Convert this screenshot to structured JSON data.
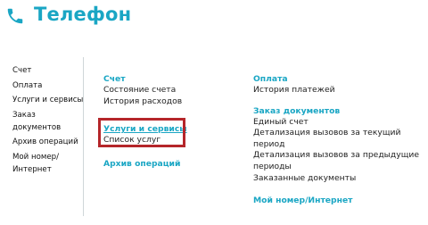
{
  "header": {
    "title": "Телефон",
    "icon": "phone-icon",
    "accent": "#1aa6c4"
  },
  "sidebar": {
    "items": [
      {
        "label": "Счет"
      },
      {
        "label": "Оплата"
      },
      {
        "label": "Услуги и сервисы"
      },
      {
        "label": "Заказ документов"
      },
      {
        "label": "Архив операций"
      },
      {
        "label": "Мой номер/Интернет"
      }
    ]
  },
  "main": {
    "account": {
      "heading": "Счет",
      "links": [
        "Состояние счета",
        "История расходов"
      ]
    },
    "services": {
      "heading": "Услуги и сервисы",
      "links": [
        "Список услуг"
      ],
      "highlight_color": "#b5262a"
    },
    "archive": {
      "heading": "Архив операций"
    },
    "payment": {
      "heading": "Оплата",
      "links": [
        "История платежей"
      ]
    },
    "documents": {
      "heading": "Заказ документов",
      "links": [
        "Единый счет",
        "Детализация вызовов за текущий период",
        "Детализация вызовов за предыдущие периоды",
        "Заказанные документы"
      ]
    },
    "mynumber": {
      "heading": "Мой номер/Интернет"
    }
  }
}
